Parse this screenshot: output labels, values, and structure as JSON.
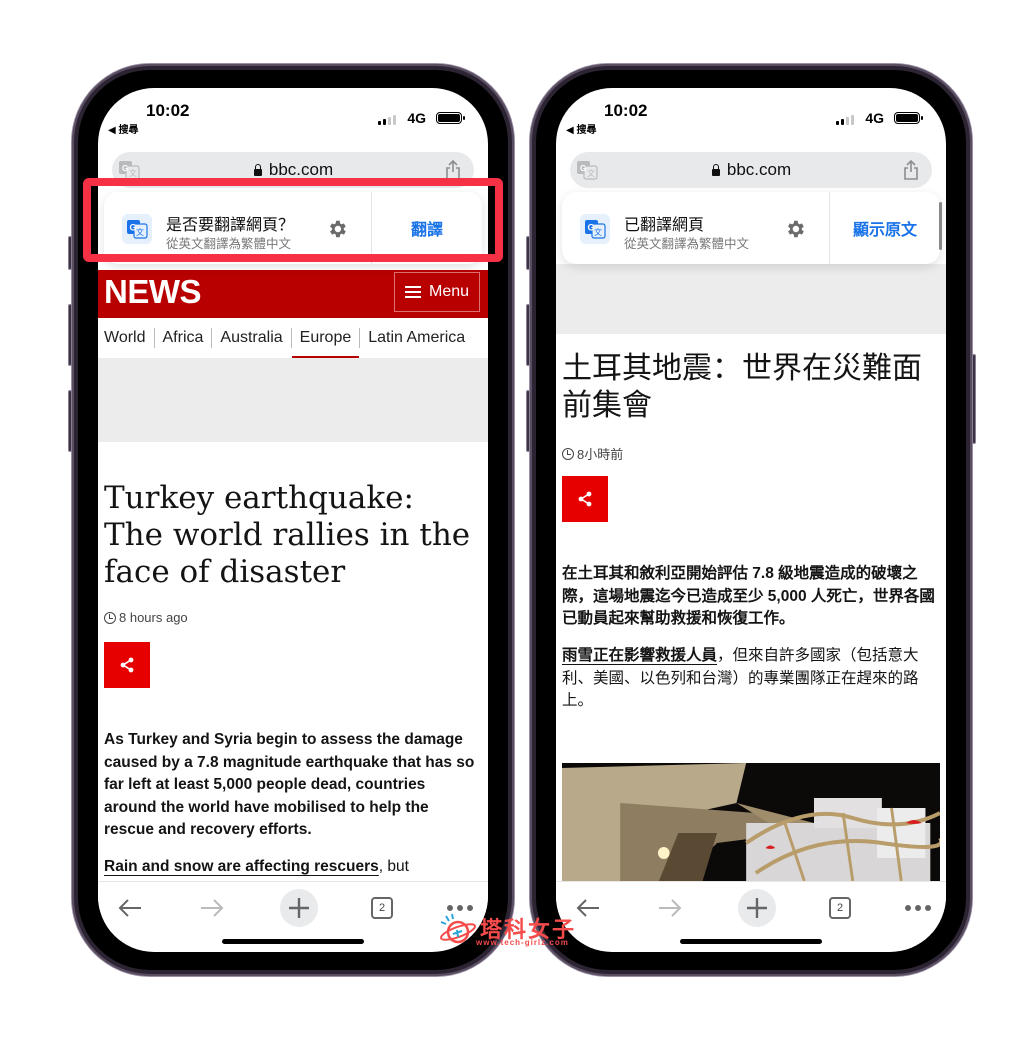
{
  "status_bar": {
    "time": "10:02",
    "back_app": "◀ 搜尋",
    "network": "4G"
  },
  "url_bar": {
    "domain": "bbc.com"
  },
  "left_phone": {
    "banner": {
      "title": "是否要翻譯網頁？",
      "subtitle": "從英文翻譯為繁體中文",
      "action": "翻譯"
    },
    "site": {
      "brand": "NEWS",
      "menu_label": "Menu",
      "nav": [
        "World",
        "Africa",
        "Australia",
        "Europe",
        "Latin America"
      ],
      "active_nav": "Europe"
    },
    "article": {
      "headline": "Turkey earthquake: The world rallies in the face of disaster",
      "timestamp": "8 hours ago",
      "lead": "As Turkey and Syria begin to assess the damage caused by a 7.8 magnitude earthquake that has so far left at least 5,000 people dead, countries around the world have mobilised to help the rescue and recovery efforts.",
      "para2_link": "Rain and snow are affecting rescuers",
      "para2_rest": ", but"
    }
  },
  "right_phone": {
    "banner": {
      "title": "已翻譯網頁",
      "subtitle": "從英文翻譯為繁體中文",
      "action": "顯示原文"
    },
    "article": {
      "headline": "土耳其地震：世界在災難面前集會",
      "timestamp": "8小時前",
      "lead": "在土耳其和敘利亞開始評估 7.8 級地震造成的破壞之際，這場地震迄今已造成至少 5,000 人死亡，世界各國已動員起來幫助救援和恢復工作。",
      "para2_link": "雨雪正在影響救援人員",
      "para2_rest": "，但來自許多國家（包括意大利、美國、以色列和台灣）的專業團隊正在趕來的路上。"
    }
  },
  "toolbar": {
    "tab_count": "2"
  },
  "watermark": {
    "text": "塔科女子",
    "url": "www.tech-girlz.com"
  },
  "colors": {
    "bbc_red": "#b80000",
    "share_red": "#e60000",
    "link_blue": "#1a73e8",
    "highlight": "#f73145"
  }
}
